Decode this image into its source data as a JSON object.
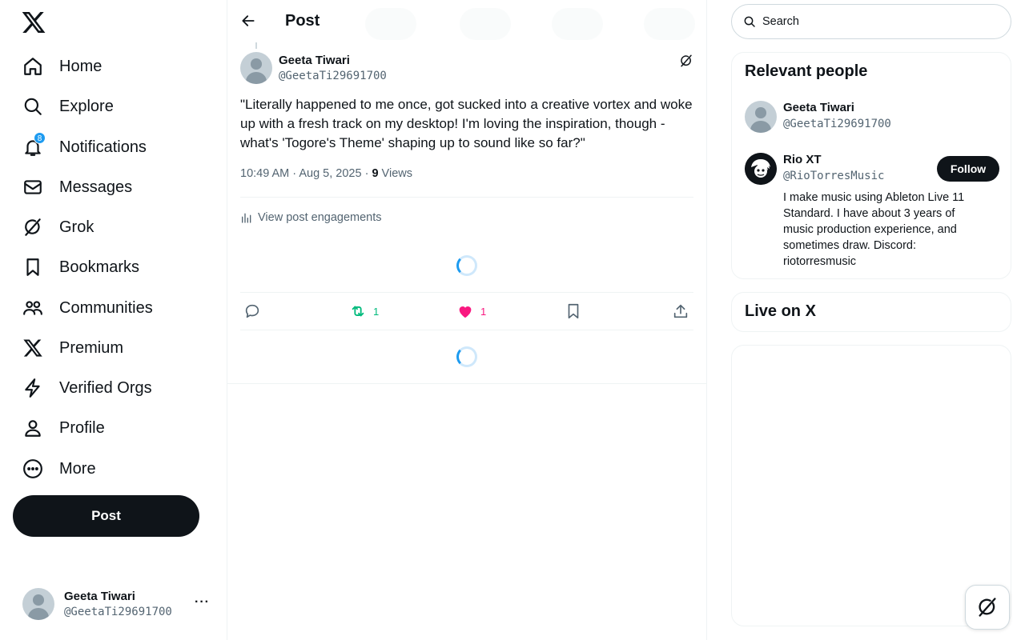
{
  "nav": {
    "items": [
      {
        "label": "Home",
        "icon": "home-icon"
      },
      {
        "label": "Explore",
        "icon": "search-icon"
      },
      {
        "label": "Notifications",
        "icon": "bell-icon"
      },
      {
        "label": "Messages",
        "icon": "mail-icon"
      },
      {
        "label": "Grok",
        "icon": "grok-icon"
      },
      {
        "label": "Bookmarks",
        "icon": "bookmark-icon"
      },
      {
        "label": "Communities",
        "icon": "people-icon"
      },
      {
        "label": "Premium",
        "icon": "x-logo-icon"
      },
      {
        "label": "Verified Orgs",
        "icon": "lightning-icon"
      },
      {
        "label": "Profile",
        "icon": "person-icon"
      },
      {
        "label": "More",
        "icon": "more-circle-icon"
      }
    ],
    "notifications_badge": "8",
    "post_button": "Post"
  },
  "account": {
    "name": "Geeta Tiwari",
    "handle": "@GeetaTi29691700",
    "more": "···"
  },
  "header": {
    "title": "Post"
  },
  "tweet": {
    "author_name": "Geeta Tiwari",
    "author_handle": "@GeetaTi29691700",
    "text": "\"Literally happened to me once, got sucked into a creative vortex and woke up with a fresh track on my desktop! I'm loving the inspiration, though - what's 'Togore's Theme' shaping up to sound like so far?\"",
    "time": "10:49 AM · Aug 5, 2025 · ",
    "views_count": "9",
    "views_label": " Views",
    "engagements_link": "View post engagements",
    "retweets": "1",
    "likes": "1"
  },
  "search": {
    "placeholder": "Search"
  },
  "relevant": {
    "title": "Relevant people",
    "people": [
      {
        "name": "Geeta Tiwari",
        "handle": "@GeetaTi29691700"
      },
      {
        "name": "Rio XT",
        "handle": "@RioTorresMusic",
        "bio": "I make music using Ableton Live 11 Standard. I have about 3 years of music production experience, and sometimes draw. Discord: riotorresmusic",
        "follow": "Follow"
      }
    ]
  },
  "live": {
    "title": "Live on X"
  },
  "colors": {
    "text": "#0f1419",
    "secondary": "#536471",
    "accent": "#1d9bf0",
    "retweet": "#00ba7c",
    "like": "#f91880",
    "border": "#eff3f4"
  }
}
